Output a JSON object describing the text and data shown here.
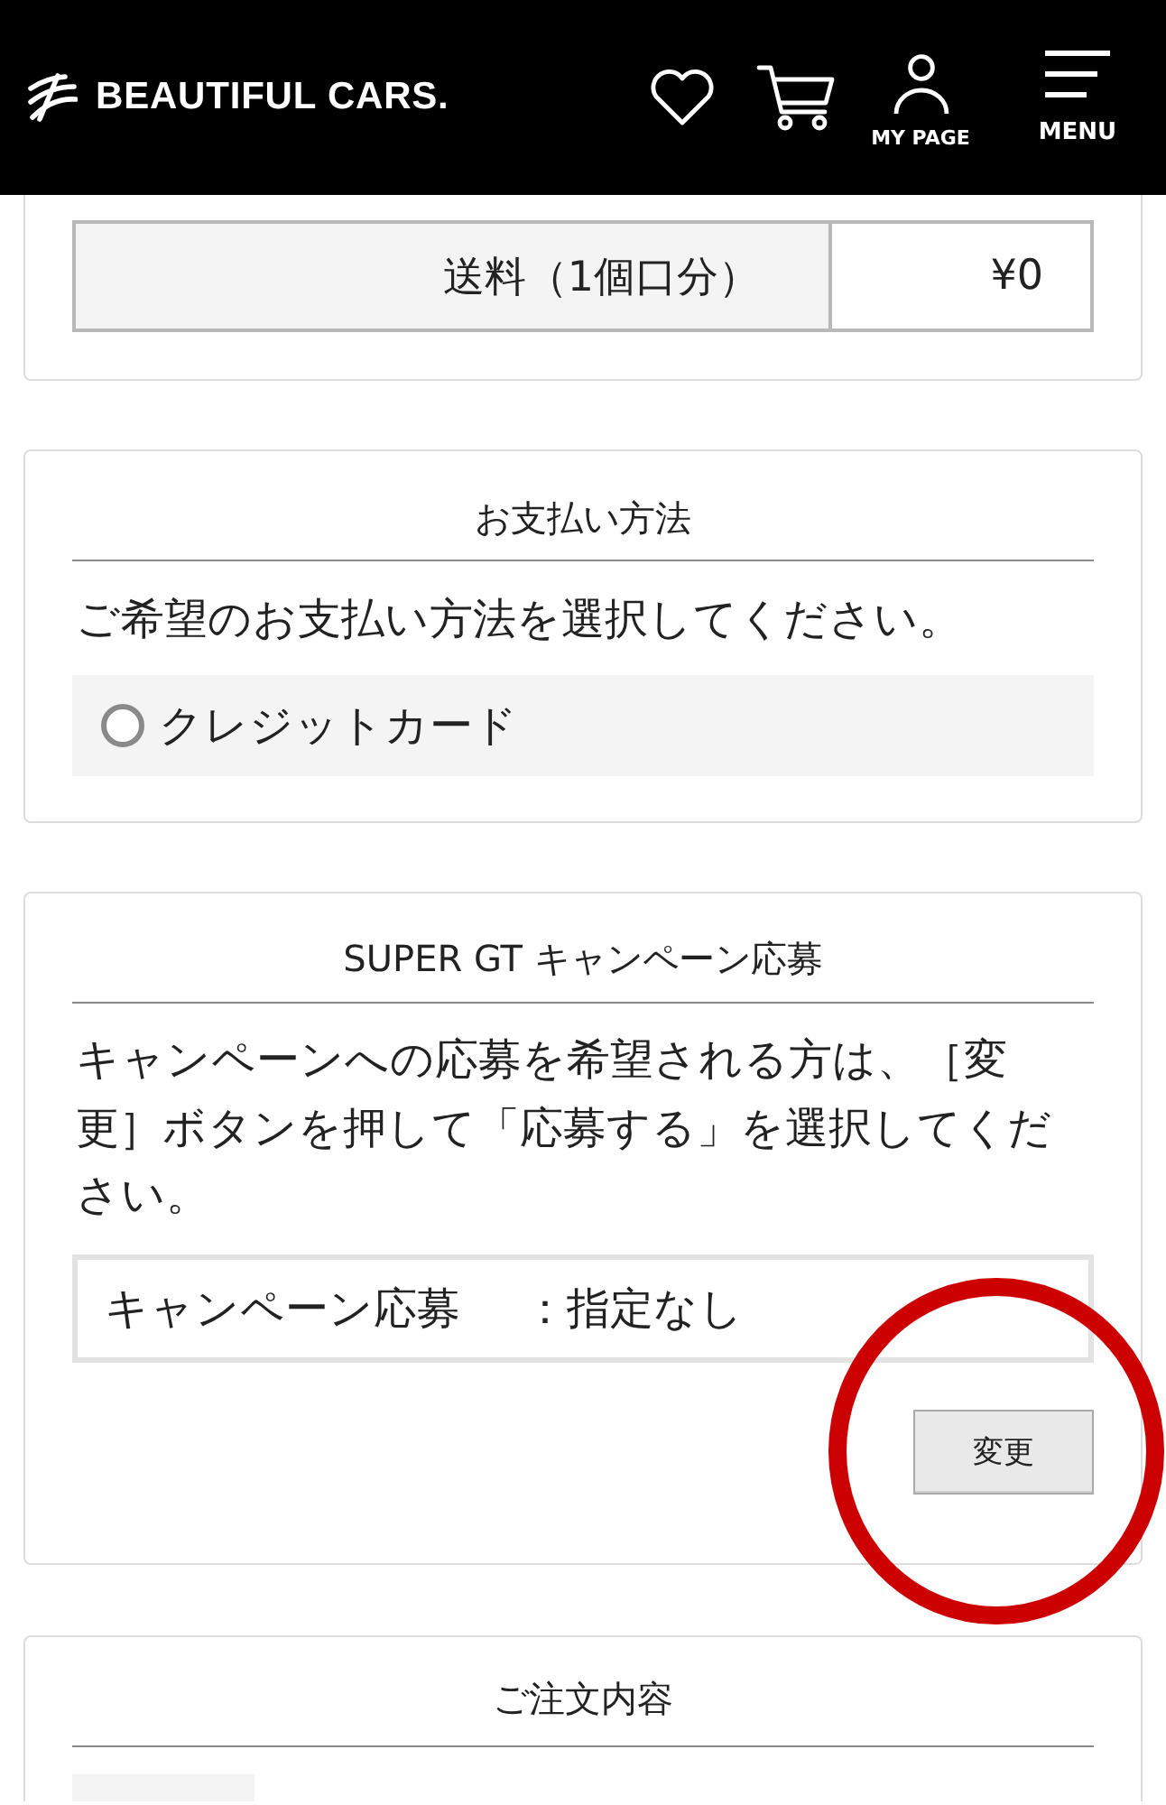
{
  "header": {
    "logo": "BEAUTIFUL CARS.",
    "nav": [
      {
        "kind": "favorites"
      },
      {
        "kind": "cart"
      },
      {
        "kind": "account",
        "label": "MY PAGE"
      },
      {
        "kind": "menu",
        "label": "MENU"
      }
    ]
  },
  "shipping": {
    "rows": [
      {
        "label": "送料（1個口分）",
        "value": "¥0"
      }
    ]
  },
  "payment": {
    "title": "お支払い方法",
    "instruction": "ご希望のお支払い方法を選択してください。",
    "options": [
      {
        "label": "クレジットカード",
        "selected": false
      }
    ]
  },
  "campaign": {
    "title": "SUPER GT キャンペーン応募",
    "instruction": "キャンペーンへの応募を希望される方は、［変更］ボタンを押して「応募する」を選択してください。",
    "status": {
      "label": "キャンペーン応募",
      "value": "：指定なし"
    },
    "button": {
      "label": "変更",
      "highlighted": true
    }
  },
  "order": {
    "title": "ご注文内容",
    "items": [
      {
        "kind": "photo"
      }
    ]
  }
}
